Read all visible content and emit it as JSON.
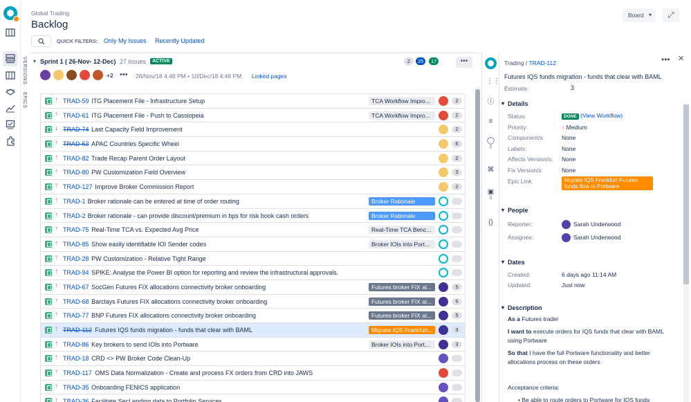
{
  "header": {
    "breadcrumb": "Global Trading",
    "title": "Backlog",
    "board_button": "Board",
    "quick_filters_label": "QUICK FILTERS:",
    "quick_filters": [
      "Only My Issues",
      "Recently Updated"
    ]
  },
  "side_tabs": [
    "VERSIONS",
    "EPICS"
  ],
  "sprint": {
    "name": "Sprint 1 ( 26-Nov- 12-Dec)",
    "issue_count": "27 issues",
    "status": "ACTIVE",
    "counts": [
      {
        "value": "2",
        "color": "#dfe1e6",
        "text": "#172b4d"
      },
      {
        "value": "25",
        "color": "#0052cc",
        "text": "#ffffff"
      },
      {
        "value": "17",
        "color": "#00875a",
        "text": "#ffffff"
      }
    ],
    "more_assignees": "+2",
    "dates": "26/Nov/18 4:46 PM  •  10/Dec/18 4:46 PM",
    "linked_pages": "Linked pages"
  },
  "issues": [
    {
      "key": "TRAD-59",
      "summary": "ITG Placement File - Infrastructure Setup",
      "priority": "up",
      "done": false,
      "epic": "TCA Workflow Impro...",
      "epic_style": "grey",
      "avatar": "red",
      "estimate": "2"
    },
    {
      "key": "TRAD-61",
      "summary": "ITG Placement File - Push to Cassiopeia",
      "priority": "up",
      "done": false,
      "epic": "TCA Workflow Impro...",
      "epic_style": "grey",
      "avatar": "red",
      "estimate": "2"
    },
    {
      "key": "TRAD-74",
      "summary": "Last Capacity Field Improvement",
      "priority": "down",
      "done": true,
      "epic": "",
      "epic_style": "",
      "avatar": "blonde",
      "estimate": "2"
    },
    {
      "key": "TRAD-53",
      "summary": "APAC Countries Specific Wheel",
      "priority": "up",
      "done": true,
      "epic": "",
      "epic_style": "",
      "avatar": "blonde",
      "estimate": "6"
    },
    {
      "key": "TRAD-82",
      "summary": "Trade Recap Parent Order Layout",
      "priority": "up",
      "done": false,
      "epic": "",
      "epic_style": "",
      "avatar": "blonde",
      "estimate": "2"
    },
    {
      "key": "TRAD-80",
      "summary": "PW Customization Field Overview",
      "priority": "up",
      "done": false,
      "epic": "",
      "epic_style": "",
      "avatar": "blonde",
      "estimate": "3"
    },
    {
      "key": "TRAD-127",
      "summary": "Improve Broker Commission Report",
      "priority": "up",
      "done": false,
      "epic": "",
      "epic_style": "",
      "avatar": "blonde",
      "estimate": "2"
    },
    {
      "key": "TRAD-1",
      "summary": "Broker rationale can be entered at time of order routing",
      "priority": "up",
      "done": false,
      "epic": "Broker Rationale",
      "epic_style": "blue",
      "avatar": "teal",
      "estimate": ""
    },
    {
      "key": "TRAD-2",
      "summary": "Broker rationale - can provide discount/premium in bps for risk book cash orders",
      "priority": "up",
      "done": false,
      "epic": "Broker Rationale",
      "epic_style": "blue",
      "avatar": "teal",
      "estimate": ""
    },
    {
      "key": "TRAD-75",
      "summary": "Real-Time TCA vs. Expected Avg Price",
      "priority": "up",
      "done": false,
      "epic": "Real-Time TCA Benc...",
      "epic_style": "grey",
      "avatar": "teal",
      "estimate": ""
    },
    {
      "key": "TRAD-85",
      "summary": "Show easily identifiable IOI Sender codes",
      "priority": "up",
      "done": false,
      "epic": "Broker IOIs into Port...",
      "epic_style": "grey",
      "avatar": "teal",
      "estimate": ""
    },
    {
      "key": "TRAD-28",
      "summary": "PW Customization - Relative Tight Range",
      "priority": "up",
      "done": false,
      "epic": "",
      "epic_style": "",
      "avatar": "teal",
      "estimate": ""
    },
    {
      "key": "TRAD-94",
      "summary": "SPIKE: Analyse the Power BI option for reporting and review the infrastructural approvals.",
      "priority": "up",
      "done": false,
      "epic": "",
      "epic_style": "",
      "avatar": "teal",
      "estimate": ""
    },
    {
      "key": "TRAD-67",
      "summary": "SocGen Futures FIX allocations connectivity broker onboarding",
      "priority": "up",
      "done": false,
      "epic": "Futures broker FIX al...",
      "epic_style": "dark",
      "avatar": "dark",
      "estimate": "5"
    },
    {
      "key": "TRAD-68",
      "summary": "Barclays Futures FIX allocations connectivity broker onboarding",
      "priority": "up",
      "done": false,
      "epic": "Futures broker FIX al...",
      "epic_style": "dark",
      "avatar": "dark",
      "estimate": "5"
    },
    {
      "key": "TRAD-77",
      "summary": "BNP Futures FIX allocations connectivity broker onboarding",
      "priority": "up",
      "done": false,
      "epic": "Futures broker FIX al...",
      "epic_style": "dark",
      "avatar": "dark",
      "estimate": "5"
    },
    {
      "key": "TRAD-112",
      "summary": "Futures IQS funds migration - funds that clear with BAML",
      "priority": "up",
      "done": true,
      "epic": "Migrate IQS Frankfurt...",
      "epic_style": "orange",
      "avatar": "dark",
      "estimate": "3",
      "selected": true
    },
    {
      "key": "TRAD-86",
      "summary": "Key brokers to send IOIs into Portware",
      "priority": "up",
      "done": false,
      "epic": "Broker IOIs into Port...",
      "epic_style": "grey",
      "avatar": "dark",
      "estimate": "3"
    },
    {
      "key": "TRAD-18",
      "summary": "CRD <> PW Broker Code Clean-Up",
      "priority": "up",
      "done": false,
      "epic": "",
      "epic_style": "",
      "avatar": "purple",
      "estimate": ""
    },
    {
      "key": "TRAD-117",
      "summary": "OMS Data Normalization - Create and process FX orders from CRD into JAWS",
      "priority": "up",
      "done": false,
      "epic": "",
      "epic_style": "",
      "avatar": "red",
      "estimate": ""
    },
    {
      "key": "TRAD-35",
      "summary": "Onboarding FENICS application",
      "priority": "up",
      "done": false,
      "epic": "",
      "epic_style": "",
      "avatar": "purple",
      "estimate": ""
    },
    {
      "key": "TRAD-36",
      "summary": "Facilitate SecLending data to Portfolio Services",
      "priority": "up",
      "done": false,
      "epic": "",
      "epic_style": "",
      "avatar": "purple",
      "estimate": ""
    }
  ],
  "detail": {
    "project": "Trading",
    "issue_key": "TRAD-112",
    "title": "Futures IQS funds migration - funds that clear with BAML",
    "estimate_label": "Estimate:",
    "estimate_value": "3",
    "comments_count": "2",
    "attachments_count": "0",
    "details_header": "Details",
    "fields": {
      "status_label": "Status:",
      "status_value": "DONE",
      "status_link": "(View Workflow)",
      "priority_label": "Priority:",
      "priority_value": "Medium",
      "components_label": "Component/s:",
      "components_value": "None",
      "labels_label": "Labels:",
      "labels_value": "None",
      "affects_label": "Affects Version/s:",
      "affects_value": "None",
      "fix_label": "Fix Version/s:",
      "fix_value": "None",
      "epic_label": "Epic Link:",
      "epic_value": "Migrate IQS Frankfurt Futures funds flow to Portware"
    },
    "people_header": "People",
    "reporter_label": "Reporter:",
    "reporter": "Sarah Underwood",
    "assignee_label": "Assignee:",
    "assignee": "Sarah Underwood",
    "dates_header": "Dates",
    "created_label": "Created:",
    "created": "6 days ago 11:14 AM",
    "updated_label": "Updated:",
    "updated": "Just now",
    "description_header": "Description",
    "desc_as_a": "As a",
    "desc_as_a_text": " Futures trader",
    "desc_want": "I want to",
    "desc_want_text": " execute orders for IQS funds that clear with BAML using Portware",
    "desc_so": "So that",
    "desc_so_text": " I have the full Portware functionality and better allocations process on these orders",
    "acceptance": "Acceptance criteria:",
    "bullet": "Be able to route orders to Portware for IQS funds"
  },
  "colors": {
    "accent": "#0052cc",
    "story_green": "#36b37e",
    "epic_orange": "#ff8b00",
    "epic_blue": "#4c9aff",
    "epic_dark": "#6b778c",
    "done_green": "#00875a"
  }
}
